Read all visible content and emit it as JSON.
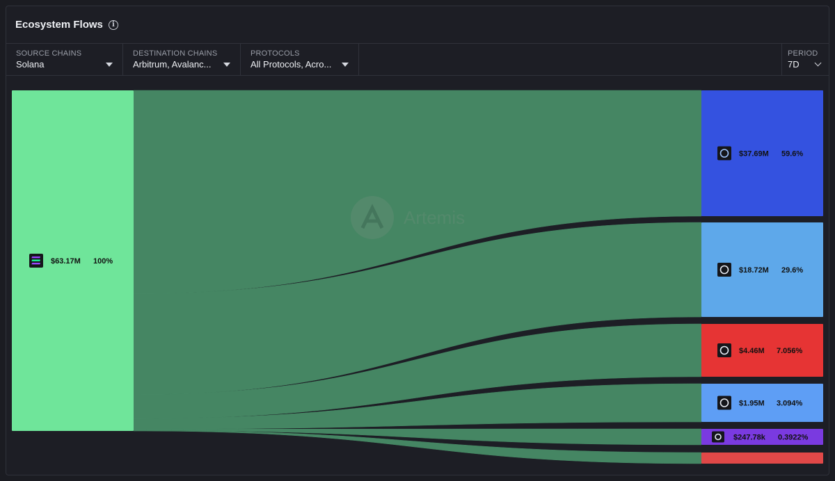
{
  "header": {
    "title": "Ecosystem Flows",
    "info_icon": "info-icon"
  },
  "filters": {
    "source": {
      "label": "SOURCE CHAINS",
      "value": "Solana"
    },
    "destination": {
      "label": "DESTINATION CHAINS",
      "value": "Arbitrum, Avalanc..."
    },
    "protocols": {
      "label": "PROTOCOLS",
      "value": "All Protocols, Acro..."
    },
    "period": {
      "label": "PERIOD",
      "value": "7D"
    }
  },
  "watermark": "Artemis",
  "colors": {
    "source_node": "#6fe59a",
    "flow": "#478a66",
    "panel": "#1d1e25"
  },
  "chart_data": {
    "type": "sankey",
    "source": {
      "name": "Solana",
      "value_label": "$63.17M",
      "pct_label": "100%",
      "icon": "solana-icon",
      "color": "#6fe59a"
    },
    "targets": [
      {
        "value_label": "$37.69M",
        "pct_label": "59.6%",
        "value": 37.69,
        "pct": 59.6,
        "icon": "chain-icon-1",
        "color": "#3452e0"
      },
      {
        "value_label": "$18.72M",
        "pct_label": "29.6%",
        "value": 18.72,
        "pct": 29.6,
        "icon": "chain-icon-2",
        "color": "#5ea8ea"
      },
      {
        "value_label": "$4.46M",
        "pct_label": "7.056%",
        "value": 4.46,
        "pct": 7.056,
        "icon": "chain-icon-3",
        "color": "#e63434"
      },
      {
        "value_label": "$1.95M",
        "pct_label": "3.094%",
        "value": 1.95,
        "pct": 3.094,
        "icon": "chain-icon-4",
        "color": "#5e9ef5"
      },
      {
        "value_label": "$247.78k",
        "pct_label": "0.3922%",
        "value": 0.24778,
        "pct": 0.3922,
        "icon": "chain-icon-5",
        "color": "#7a3ae0"
      },
      {
        "value_label": "",
        "pct_label": "",
        "value": 0.1,
        "pct": 0.16,
        "icon": "",
        "color": "#e04848"
      }
    ]
  }
}
